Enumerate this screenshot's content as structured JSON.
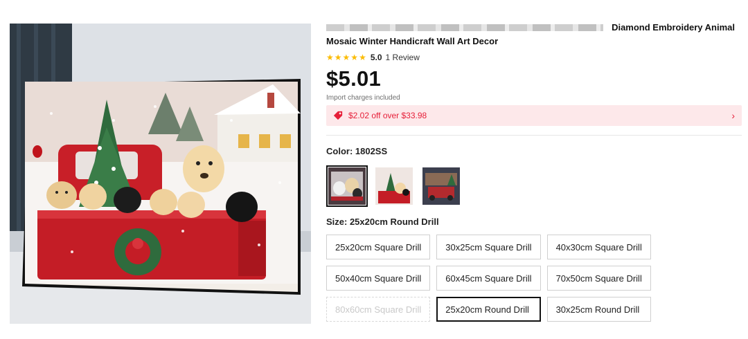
{
  "product": {
    "title_line1": "Diamond Embroidery Animal",
    "title_line2": "Mosaic Winter Handicraft Wall Art Decor",
    "rating_value": "5.0",
    "review_count": "1 Review",
    "stars": 5,
    "price": "$5.01",
    "import_note": "Import charges included"
  },
  "coupon": {
    "text": "$2.02 off over $33.98",
    "icon": "tag-icon",
    "chevron": "›"
  },
  "color": {
    "label": "Color: 1802SS",
    "options": [
      "swatch-1",
      "swatch-2",
      "swatch-3"
    ],
    "selected_index": 0
  },
  "size": {
    "label": "Size: 25x20cm Round Drill",
    "options": [
      {
        "label": "25x20cm Square Drill",
        "state": "normal"
      },
      {
        "label": "30x25cm Square Drill",
        "state": "normal"
      },
      {
        "label": "40x30cm Square Drill",
        "state": "normal"
      },
      {
        "label": "50x40cm Square Drill",
        "state": "normal"
      },
      {
        "label": "60x45cm Square Drill",
        "state": "normal"
      },
      {
        "label": "70x50cm Square Drill",
        "state": "normal"
      },
      {
        "label": "80x60cm Square Drill",
        "state": "disabled"
      },
      {
        "label": "25x20cm Round Drill",
        "state": "selected"
      },
      {
        "label": "30x25cm Round Drill",
        "state": "normal"
      }
    ]
  },
  "colors": {
    "accent_red": "#e61e38",
    "coupon_bg": "#fde8ea",
    "star": "#fbbc06"
  }
}
